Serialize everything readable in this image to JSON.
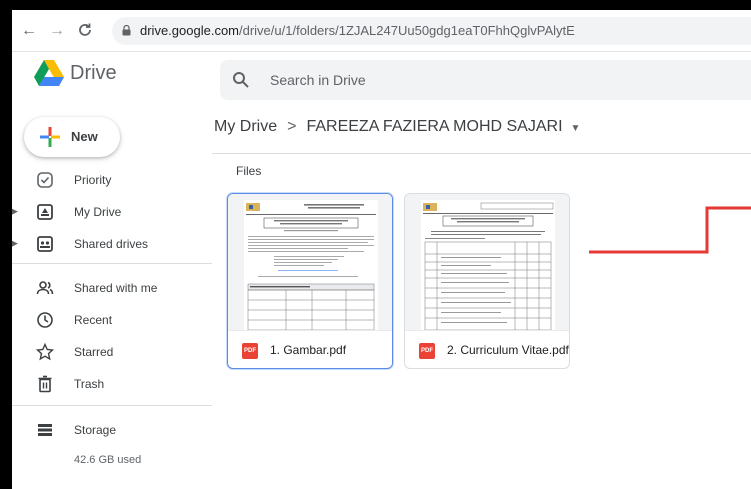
{
  "browser": {
    "url_host": "drive.google.com",
    "url_path": "/drive/u/1/folders/1ZJAL247Uu50gdg1eaT0FhhQglvPAlytE"
  },
  "header": {
    "brand": "Drive",
    "search_placeholder": "Search in Drive"
  },
  "sidebar": {
    "new_label": "New",
    "items": [
      {
        "label": "Priority",
        "icon": "priority-icon"
      },
      {
        "label": "My Drive",
        "icon": "my-drive-icon"
      },
      {
        "label": "Shared drives",
        "icon": "shared-drives-icon"
      },
      {
        "label": "Shared with me",
        "icon": "shared-with-me-icon"
      },
      {
        "label": "Recent",
        "icon": "recent-icon"
      },
      {
        "label": "Starred",
        "icon": "star-icon"
      },
      {
        "label": "Trash",
        "icon": "trash-icon"
      },
      {
        "label": "Storage",
        "icon": "storage-icon"
      }
    ],
    "storage_used": "42.6 GB used"
  },
  "breadcrumb": {
    "root": "My Drive",
    "current": "FAREEZA FAZIERA MOHD SAJARI"
  },
  "files": {
    "section_label": "Files",
    "items": [
      {
        "name": "1. Gambar.pdf",
        "type_label": "PDF",
        "selected": true
      },
      {
        "name": "2. Curriculum Vitae.pdf",
        "type_label": "PDF",
        "selected": false
      }
    ]
  },
  "colors": {
    "accent": "#1a73e8",
    "pdf_red": "#ea4335",
    "annotation_red": "#e53935"
  }
}
